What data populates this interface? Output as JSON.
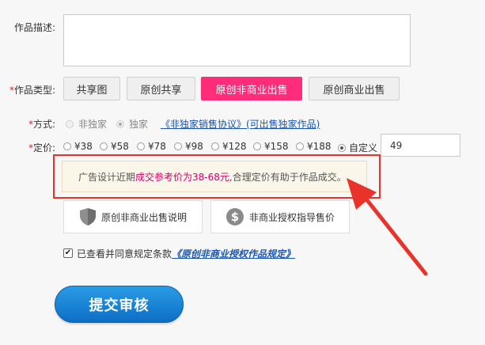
{
  "description": {
    "label": "作品描述:",
    "value": ""
  },
  "work_type": {
    "required_mark": "*",
    "label": "作品类型:",
    "options": [
      "共享图",
      "原创共享",
      "原创非商业出售",
      "原创商业出售"
    ],
    "selected": "原创非商业出售"
  },
  "mode": {
    "required_mark": "*",
    "label": "方式:",
    "options": [
      {
        "label": "非独家",
        "checked": false
      },
      {
        "label": "独家",
        "checked": true
      }
    ],
    "agreement_link": "《非独家销售协议》(可出售独家作品)"
  },
  "pricing": {
    "required_mark": "*",
    "label": "定价:",
    "options": [
      "¥38",
      "¥58",
      "¥78",
      "¥98",
      "¥128",
      "¥158",
      "¥188",
      "自定义"
    ],
    "selected": "自定义",
    "custom_value": "49"
  },
  "hint": {
    "prefix": "广告设计近期",
    "highlight": "成交参考价为38-68元",
    "suffix": ",合理定价有助于作品成交。"
  },
  "info_buttons": {
    "sale_guide": "原创非商业出售说明",
    "price_guide": "非商业授权指导售价"
  },
  "agreement": {
    "checked": true,
    "check_mark": "✔",
    "text": "已查看并同意规定条款",
    "link": "《原创非商业授权作品规定》"
  },
  "submit": {
    "label": "提交审核"
  },
  "colors": {
    "accent_pink": "#ff2d79",
    "highlight_red": "#e8322a",
    "link_blue": "#1a55b0",
    "submit_blue": "#1077cc"
  },
  "icons": {
    "shield": "shield-icon",
    "dollar": "dollar-coin-icon",
    "arrow": "red-arrow-icon"
  }
}
